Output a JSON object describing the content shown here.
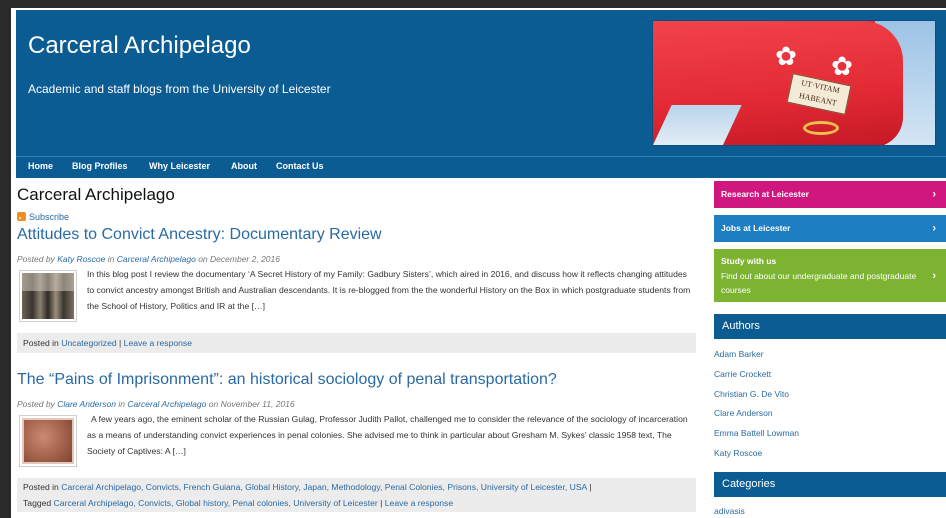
{
  "site": {
    "title": "Carceral Archipelago",
    "description": "Academic and staff blogs from the University of Leicester"
  },
  "banner": {
    "motto_line1": "UT·VITAM",
    "motto_line2": "HABEANT"
  },
  "colors": {
    "header_blue": "#0c5c94",
    "link_blue": "#2a6aa3",
    "research_pink": "#d0177f",
    "jobs_blue": "#1d7ec2",
    "study_green": "#7cb432"
  },
  "nav": [
    "Home",
    "Blog Profiles",
    "Why Leicester",
    "About",
    "Contact Us"
  ],
  "page_heading": "Carceral Archipelago",
  "subscribe": "Subscribe",
  "posts": [
    {
      "title": "Attitudes to Convict Ancestry: Documentary Review",
      "meta_prefix": "Posted by",
      "author": "Katy Roscoe",
      "meta_in": "in",
      "category": "Carceral Archipelago",
      "meta_on": "on",
      "date": "December 2, 2016",
      "excerpt": "In this blog post I review the documentary ‘A Secret History of my Family: Gadbury Sisters’, which aired in 2016, and discuss how it reflects changing attitudes to convict ancestry amongst British and Australian descendants. It is re-blogged from the the wonderful History on the Box in which postgraduate students from the School of History, Politics and IR at the […]",
      "foot_posted_in": "Posted in",
      "foot_category": "Uncategorized",
      "foot_sep": "|",
      "foot_response": "Leave a response"
    },
    {
      "title": "The “Pains of Imprisonment”: an historical sociology of penal transportation?",
      "meta_prefix": "Posted by",
      "author": "Clare Anderson",
      "meta_in": "in",
      "category": "Carceral Archipelago",
      "meta_on": "on",
      "date": "November 11, 2016",
      "excerpt": "A few years ago, the eminent scholar of the Russian Gulag, Professor Judith Pallot, challenged me to consider the relevance of the sociology of incarceration as a means of understanding convict experiences in penal colonies. She advised me to think in particular about Gresham M. Sykes’ classic 1958 text, The Society of Captives: A […]",
      "foot_posted_in": "Posted in",
      "foot_categories": "Carceral Archipelago, Convicts, French Guiana, Global History, Japan, Methodology, Penal Colonies, Prisons, University of Leicester, USA",
      "foot_sep": "|",
      "foot_tagged": "Tagged",
      "foot_tags": "Carceral Archipelago, Convicts, Global history, Penal colonies, University of Leicester",
      "foot_response": "Leave a response"
    }
  ],
  "sidebar": {
    "research": "Research at Leicester",
    "jobs": "Jobs at Leicester",
    "study_title": "Study with us",
    "study_sub": "Find out about our undergraduate and postgraduate courses",
    "arrow": "›",
    "authors_heading": "Authors",
    "authors": [
      "Adam Barker",
      "Carrie Crockett",
      "Christian G. De Vito",
      "Clare Anderson",
      "Emma Battell Lowman",
      "Katy Roscoe"
    ],
    "categories_heading": "Categories",
    "first_category": "adivasis"
  }
}
